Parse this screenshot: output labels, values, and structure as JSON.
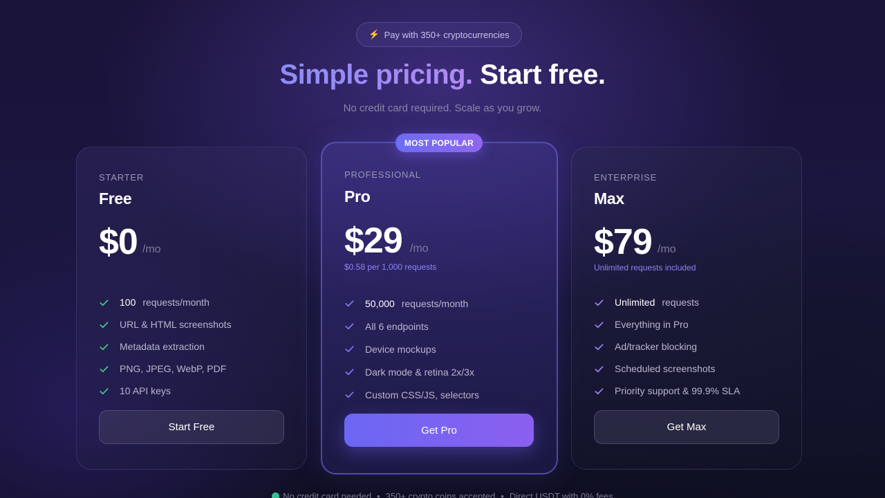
{
  "badge": {
    "icon": "lightning-icon",
    "text": "Pay with 350+ cryptocurrencies"
  },
  "hero": {
    "title_accent": "Simple pricing.",
    "title_rest": "Start free.",
    "subtitle": "No credit card required. Scale as you grow."
  },
  "colors": {
    "accent_start": "#6d6cf5",
    "accent_end": "#8f66ef",
    "starter_check": "#3ecf8e",
    "pro_check": "#7f7cf5",
    "enterprise_check": "#9b86f2",
    "status_dot": "#33c28f"
  },
  "plans": [
    {
      "tier": "STARTER",
      "name": "Free",
      "price": "$0",
      "period": "/mo",
      "note": "",
      "features": [
        {
          "strong": "100",
          "text": "requests/month"
        },
        {
          "strong": "",
          "text": "URL & HTML screenshots"
        },
        {
          "strong": "",
          "text": "Metadata extraction"
        },
        {
          "strong": "",
          "text": "PNG, JPEG, WebP, PDF"
        },
        {
          "strong": "",
          "text": "10 API keys"
        }
      ],
      "cta": "Start Free"
    },
    {
      "tier": "PROFESSIONAL",
      "name": "Pro",
      "price": "$29",
      "period": "/mo",
      "note": "$0.58 per 1,000 requests",
      "badge": "MOST POPULAR",
      "features": [
        {
          "strong": "50,000",
          "text": "requests/month"
        },
        {
          "strong": "",
          "text": "All 6 endpoints"
        },
        {
          "strong": "",
          "text": "Device mockups"
        },
        {
          "strong": "",
          "text": "Dark mode & retina 2x/3x"
        },
        {
          "strong": "",
          "text": "Custom CSS/JS, selectors"
        }
      ],
      "cta": "Get Pro"
    },
    {
      "tier": "ENTERPRISE",
      "name": "Max",
      "price": "$79",
      "period": "/mo",
      "note": "Unlimited requests included",
      "features": [
        {
          "strong": "Unlimited",
          "text": "requests"
        },
        {
          "strong": "",
          "text": "Everything in Pro"
        },
        {
          "strong": "",
          "text": "Ad/tracker blocking"
        },
        {
          "strong": "",
          "text": "Scheduled screenshots"
        },
        {
          "strong": "",
          "text": "Priority support & 99.9% SLA"
        }
      ],
      "cta": "Get Max"
    }
  ],
  "footer": {
    "items": [
      "No credit card needed",
      "350+ crypto coins accepted",
      "Direct USDT with 0% fees"
    ],
    "separator": "•"
  }
}
